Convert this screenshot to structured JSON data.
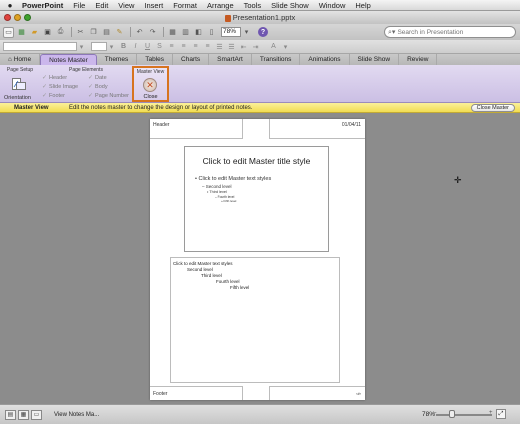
{
  "menubar": {
    "apple": "",
    "items": [
      "PowerPoint",
      "File",
      "Edit",
      "View",
      "Insert",
      "Format",
      "Arrange",
      "Tools",
      "Slide Show",
      "Window",
      "Help"
    ]
  },
  "window": {
    "title": "Presentation1.pptx"
  },
  "toolbar": {
    "zoom": "78%",
    "help": "?",
    "search_placeholder": "Search in Presentation"
  },
  "ribbon": {
    "tabs": [
      "Home",
      "Notes Master",
      "Themes",
      "Tables",
      "Charts",
      "SmartArt",
      "Transitions",
      "Animations",
      "Slide Show",
      "Review"
    ],
    "active_tab": "Notes Master",
    "page_setup": {
      "group_label": "Page Setup",
      "orientation_label": "Orientation"
    },
    "page_elements": {
      "group_label": "Page Elements",
      "items": [
        "Header",
        "Date",
        "Slide Image",
        "Body",
        "Footer",
        "Page Number"
      ]
    },
    "master_view": {
      "group_label": "Master View",
      "close_label": "Close"
    }
  },
  "message_bar": {
    "title": "Master View",
    "text": "Edit the notes master to change the design or layout of printed notes.",
    "button": "Close Master"
  },
  "notes_page": {
    "header": "Header",
    "date": "01/04/11",
    "slide_title": "Click to edit Master title style",
    "slide_levels": [
      "Click to edit Master text styles",
      "Second level",
      "Third level",
      "Fourth level",
      "Fifth level"
    ],
    "body_levels": [
      "Click to edit Master text styles",
      "Second level",
      "Third level",
      "Fourth level",
      "Fifth level"
    ],
    "footer": "Footer",
    "page_number": "‹#›"
  },
  "statusbar": {
    "view_label": "View Notes Ma...",
    "zoom": "78%"
  },
  "colors": {
    "ribbon_accent": "#cbb7ec",
    "close_highlight": "#d7741f",
    "message_bar": "#f2dd52"
  }
}
